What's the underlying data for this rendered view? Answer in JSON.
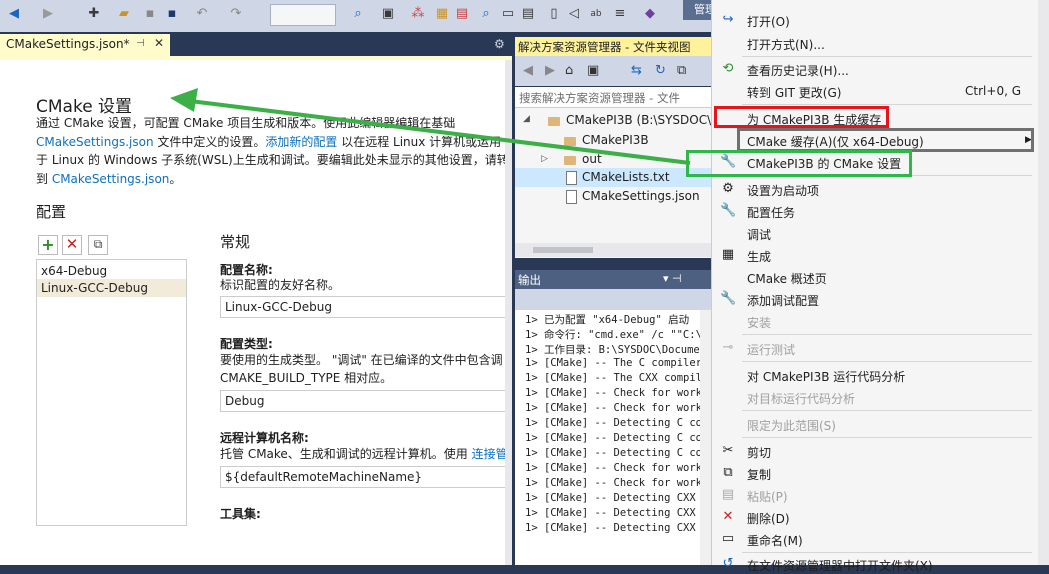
{
  "toolbar": {
    "manage_label": "管理"
  },
  "doc": {
    "tab_label": "CMakeSettings.json*",
    "title": "CMake 设置",
    "intro": {
      "l1": "通过 CMake 设置，可配置 CMake 项目生成和版本。使用此编辑器编辑在基础",
      "l2_link": "CMakeSettings.json",
      "l2_text": " 文件中定义的设置。",
      "l2_link2": "添加新的配置",
      "l2_text2": " 以在远程 Linux 计算机或运用",
      "l3": "于 Linux 的 Windows 子系统(WSL)上生成和调试。要编辑此处未显示的其他设置，请转",
      "l4_pre": "到 ",
      "l4_link": "CMakeSettings.json",
      "l4_post": "。"
    },
    "config_heading": "配置",
    "configs": [
      "x64-Debug",
      "Linux-GCC-Debug"
    ],
    "general_heading": "常规",
    "props": {
      "name_title": "配置名称:",
      "name_desc": "标识配置的友好名称。",
      "name_value": "Linux-GCC-Debug",
      "type_title": "配置类型:",
      "type_desc1": "要使用的生成类型。 \"调试\" 在已编译的文件中包含调",
      "type_desc2": "CMAKE_BUILD_TYPE 相对应。",
      "type_value": "Debug",
      "remote_title": "远程计算机名称:",
      "remote_desc": "托管 CMake、生成和调试的远程计算机。使用 ",
      "remote_desc_link": "连接管",
      "remote_value": "${defaultRemoteMachineName}",
      "tools_title": "工具集:"
    }
  },
  "solution_explorer": {
    "title": "解决方案资源管理器 - 文件夹视图",
    "search_placeholder": "搜索解决方案资源管理器 - 文件",
    "root": "CMakePI3B (B:\\SYSDOC\\D",
    "items": [
      "CMakePI3B",
      "out",
      "CMakeLists.txt",
      "CMakeSettings.json"
    ]
  },
  "output": {
    "title": "输出",
    "lines": [
      "1> 已为配置 \"x64-Debug\" 启动",
      "1> 命令行: \"cmd.exe\" /c \"\"C:\\",
      "1> 工作目录: B:\\SYSDOC\\Docume",
      "1> [CMake] -- The C compiler",
      "1> [CMake] -- The CXX compile",
      "1> [CMake] -- Check for worki",
      "1> [CMake] -- Check for worki",
      "1> [CMake] -- Detecting C com",
      "1> [CMake] -- Detecting C com",
      "1> [CMake] -- Detecting C com",
      "1> [CMake] -- Check for worki",
      "1> [CMake] -- Check for worki",
      "1> [CMake] -- Detecting CXX c",
      "1> [CMake] -- Detecting CXX c",
      "1> [CMake] -- Detecting CXX c"
    ]
  },
  "context_menu": {
    "open": "打开(O)",
    "open_with": "打开方式(N)...",
    "view_history": "查看历史记录(H)...",
    "goto_git": "转到 GIT 更改(G)",
    "goto_git_shortcut": "Ctrl+0, G",
    "gen_cache": "为 CMakePI3B 生成缓存",
    "cmake_cache": "CMake 缓存(A)(仅 x64-Debug)",
    "cmake_settings": "CMakePI3B 的 CMake 设置",
    "set_startup": "设置为启动项",
    "config_tasks": "配置任务",
    "debug": "调试",
    "build": "生成",
    "cmake_overview": "CMake 概述页",
    "add_debug_config": "添加调试配置",
    "install": "安装",
    "run_tests": "运行测试",
    "run_analysis": "对 CMakePI3B 运行代码分析",
    "analysis_target": "对目标运行代码分析",
    "limit_scope": "限定为此范围(S)",
    "cut": "剪切",
    "copy": "复制",
    "paste": "粘贴(P)",
    "delete": "删除(D)",
    "rename": "重命名(M)",
    "open_in_explorer": "在文件资源管理器中打开文件夹(X)"
  },
  "colors": {
    "red_box": "#e8141c",
    "gray_box": "#707070",
    "green_box": "#2fb84a",
    "arrow": "#3cb046",
    "link": "#0e70c0"
  }
}
